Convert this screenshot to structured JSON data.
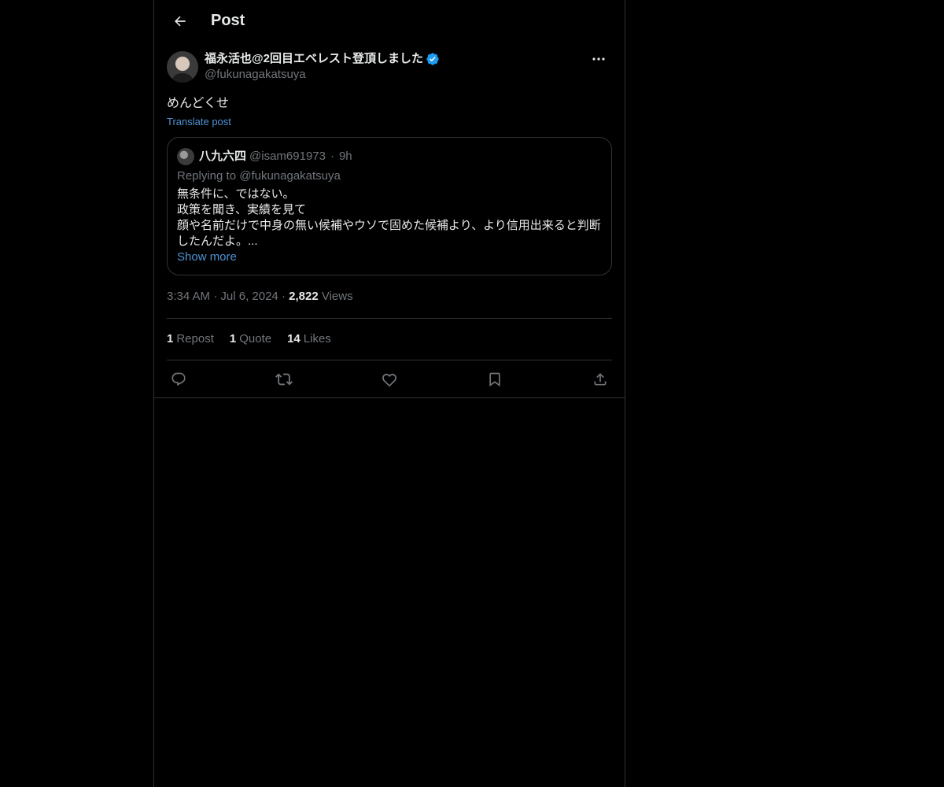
{
  "header": {
    "title": "Post"
  },
  "post": {
    "author_name": "福永活也@2回目エベレスト登頂しました",
    "author_handle": "@fukunagakatsuya",
    "text": "めんどくせ",
    "translate_label": "Translate post",
    "quote": {
      "name": "八九六四",
      "handle": "@isam691973",
      "separator": "·",
      "time": "9h",
      "replying_to": "Replying to @fukunagakatsuya",
      "lines": [
        "無条件に、ではない。",
        "政策を聞き、実績を見て",
        "顔や名前だけで中身の無い候補やウソで固めた候補より、より信用出来ると判断したんだよ。..."
      ],
      "show_more": "Show more"
    },
    "meta": {
      "time": "3:34 AM",
      "sep": "·",
      "date": "Jul 6, 2024",
      "views_count": "2,822",
      "views_label": "Views"
    },
    "stats": {
      "reposts_count": "1",
      "reposts_label": "Repost",
      "quotes_count": "1",
      "quotes_label": "Quote",
      "likes_count": "14",
      "likes_label": "Likes"
    }
  },
  "icons": {
    "back": "arrow-left-icon",
    "verified": "verified-badge-icon",
    "more": "more-dots-icon",
    "reply": "reply-icon",
    "repost": "repost-icon",
    "like": "heart-icon",
    "bookmark": "bookmark-icon",
    "share": "share-icon"
  },
  "colors": {
    "background": "#000000",
    "text": "#e7e9ea",
    "muted": "#71767b",
    "border": "#2f3336",
    "accent": "#1d9bf0",
    "link": "#4f93d6"
  }
}
